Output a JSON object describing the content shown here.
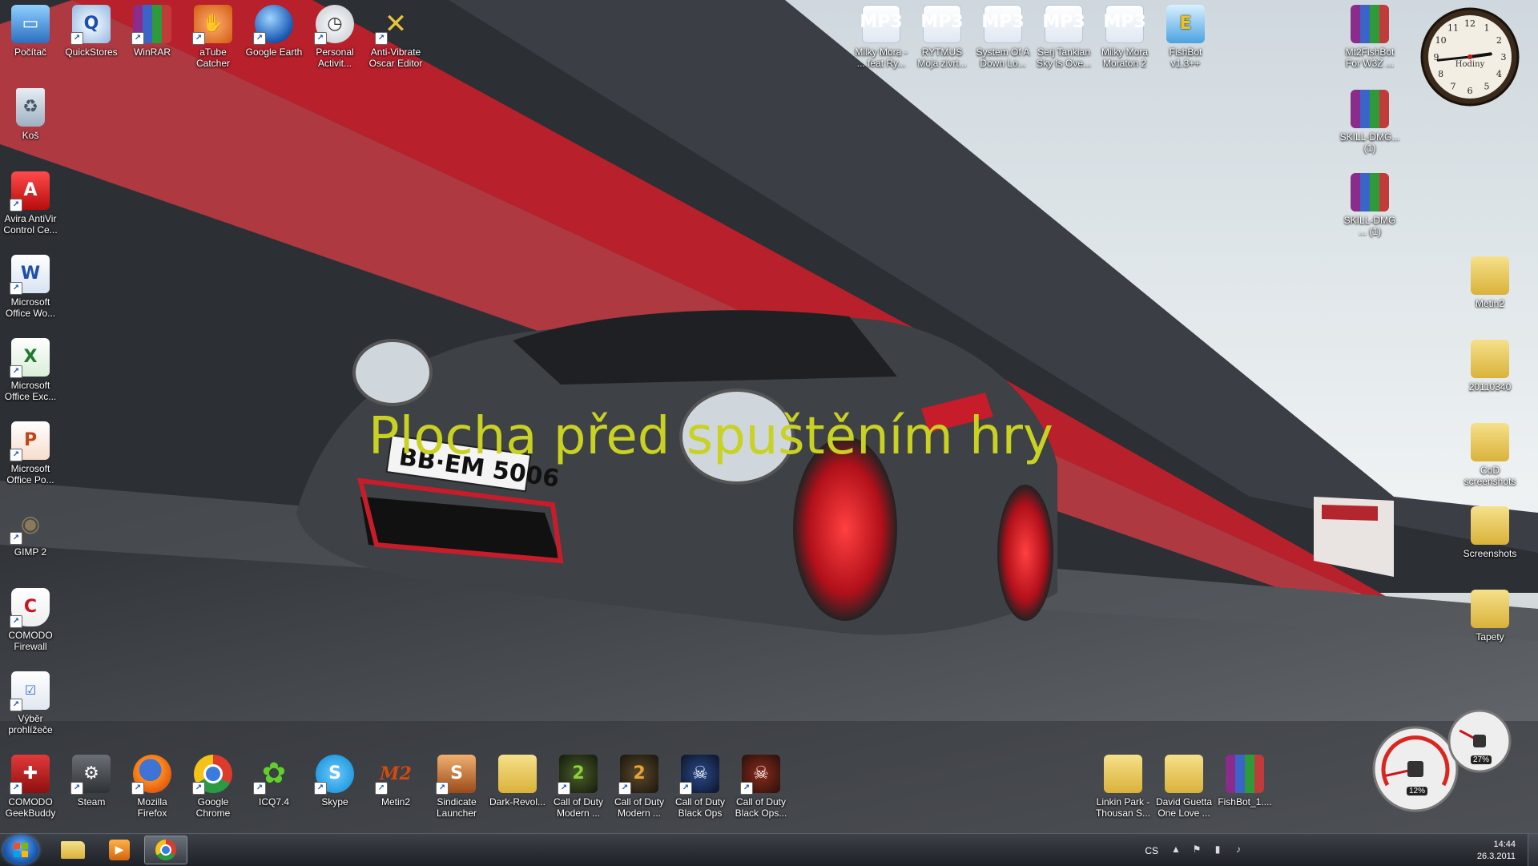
{
  "overlay_title": "Plocha před spuštěním hry",
  "desktop_icons_top_left": [
    {
      "label": "Počítač",
      "icon": "computer-icon"
    },
    {
      "label": "QuickStores",
      "icon": "quickstores-icon"
    },
    {
      "label": "WinRAR",
      "icon": "winrar-icon"
    },
    {
      "label": "aTube Catcher",
      "icon": "atube-catcher-icon"
    },
    {
      "label": "Google Earth",
      "icon": "google-earth-icon"
    },
    {
      "label": "Personal Activit...",
      "icon": "personal-activity-icon"
    },
    {
      "label": "Anti-Vibrate Oscar Editor",
      "icon": "oscar-editor-icon"
    }
  ],
  "desktop_icons_left_column": [
    {
      "label": "Koš",
      "icon": "recycle-bin-icon"
    },
    {
      "label": "Avira AntiVir Control Ce...",
      "icon": "avira-icon"
    },
    {
      "label": "Microsoft Office Wo...",
      "icon": "word-icon"
    },
    {
      "label": "Microsoft Office Exc...",
      "icon": "excel-icon"
    },
    {
      "label": "Microsoft Office Po...",
      "icon": "powerpoint-icon"
    },
    {
      "label": "GIMP 2",
      "icon": "gimp-icon"
    },
    {
      "label": "COMODO Firewall",
      "icon": "comodo-firewall-icon"
    },
    {
      "label": "Výběr prohlížeče",
      "icon": "browser-choice-icon"
    }
  ],
  "desktop_icons_bottom_row": [
    {
      "label": "COMODO GeekBuddy",
      "icon": "geekbuddy-icon"
    },
    {
      "label": "Steam",
      "icon": "steam-icon"
    },
    {
      "label": "Mozilla Firefox",
      "icon": "firefox-icon"
    },
    {
      "label": "Google Chrome",
      "icon": "chrome-icon"
    },
    {
      "label": "ICQ7.4",
      "icon": "icq-icon"
    },
    {
      "label": "Skype",
      "icon": "skype-icon"
    },
    {
      "label": "Metin2",
      "icon": "metin2-icon"
    },
    {
      "label": "Sindicate Launcher",
      "icon": "sindicate-launcher-icon"
    },
    {
      "label": "Dark-Revol...",
      "icon": "folder-icon"
    },
    {
      "label": "Call of Duty Modern ...",
      "icon": "cod-mw2-icon"
    },
    {
      "label": "Call of Duty Modern ...",
      "icon": "cod-mw2-icon"
    },
    {
      "label": "Call of Duty Black Ops",
      "icon": "cod-black-ops-icon"
    },
    {
      "label": "Call of Duty Black Ops...",
      "icon": "cod-black-ops-icon"
    }
  ],
  "desktop_icons_bottom_right": [
    {
      "label": "Linkin Park - Thousan S...",
      "icon": "folder-icon"
    },
    {
      "label": "David Guetta One Love ...",
      "icon": "folder-icon"
    },
    {
      "label": "FishBot_1....",
      "icon": "winrar-archive-icon"
    }
  ],
  "desktop_icons_top_right": [
    {
      "label": "Milky Mora - ... feat Ry...",
      "icon": "mp3-file-icon"
    },
    {
      "label": "RYTMUS Moja zivrt...",
      "icon": "mp3-file-icon"
    },
    {
      "label": "System Of A Down Lo...",
      "icon": "mp3-file-icon"
    },
    {
      "label": "Serj Tankian Sky Is Ove...",
      "icon": "mp3-file-icon"
    },
    {
      "label": "Milky Mora Moraton 2",
      "icon": "mp3-file-icon"
    },
    {
      "label": "FishBot v1.3++",
      "icon": "fishbot-icon"
    }
  ],
  "desktop_icons_right_column": [
    {
      "label": "Mt2FishBot For W3Z ...",
      "icon": "winrar-archive-icon"
    },
    {
      "label": "SKILL-DMG... (1)",
      "icon": "winrar-archive-icon"
    },
    {
      "label": "SKILL-DMG ... (1)",
      "icon": "winrar-archive-icon"
    },
    {
      "label": "Metin2",
      "icon": "folder-icon"
    },
    {
      "label": "20110340",
      "icon": "folder-icon"
    },
    {
      "label": "CoD screenshots",
      "icon": "folder-icon"
    },
    {
      "label": "Screenshots",
      "icon": "folder-icon"
    },
    {
      "label": "Tapety",
      "icon": "folder-icon"
    }
  ],
  "clock_gadget": {
    "label": "Hodiny",
    "hour": 2,
    "minute": 44
  },
  "meter_gadget": {
    "cpu_percent": 12,
    "memory_percent": 27,
    "cpu_label": "12%",
    "memory_label": "27%"
  },
  "taskbar": {
    "pinned": [
      {
        "name": "windows-explorer",
        "icon": "folder-icon"
      },
      {
        "name": "media-player",
        "icon": "media-player-icon"
      },
      {
        "name": "google-chrome",
        "icon": "chrome-icon",
        "active": true
      }
    ],
    "language": "CS",
    "time": "14:44",
    "date": "26.3.2011"
  }
}
